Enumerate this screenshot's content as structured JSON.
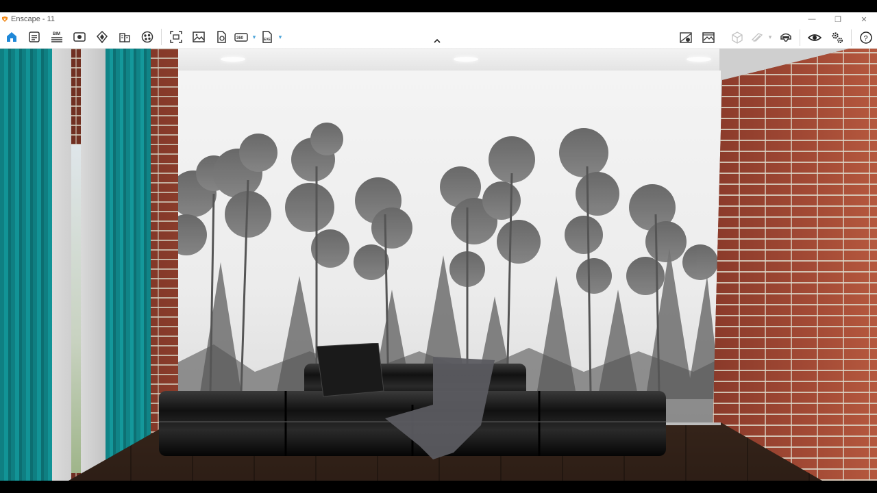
{
  "window": {
    "title": "Enscape - 11",
    "controls": {
      "minimize": "—",
      "restore": "❐",
      "close": "✕"
    }
  },
  "toolbar": {
    "left_icons": [
      "home-icon",
      "settings-panel-icon",
      "bim-icon",
      "view-icon",
      "upload-icon",
      "buildings-icon",
      "materials-icon"
    ],
    "bim_label": "BIM",
    "export_icons": [
      "screenshot-icon",
      "image-icon",
      "file-sync-icon",
      "panorama-360-icon",
      "exe-export-icon"
    ],
    "pano_label": "360",
    "exe_label": "EXE",
    "right_icons": [
      "map-pin-icon",
      "image-gallery-icon",
      "cube-icon",
      "layers-icon",
      "vr-headset-icon",
      "eye-icon",
      "gears-icon",
      "help-icon"
    ],
    "help_label": "?"
  },
  "colors": {
    "accent_blue": "#1f88d8",
    "logo_orange": "#f28c1c",
    "icon_dark": "#333333",
    "icon_disabled": "#c4c4c4",
    "curtain_teal": "#129396",
    "brick_red": "#8a3a2a"
  }
}
